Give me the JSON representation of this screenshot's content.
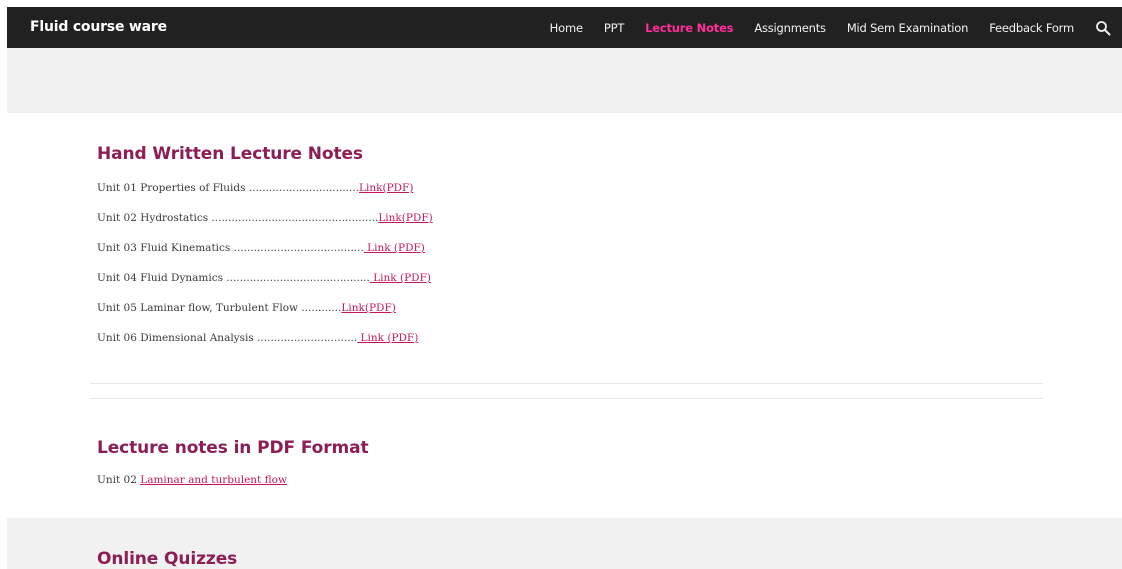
{
  "header": {
    "site_title": "Fluid course ware",
    "nav": [
      {
        "label": "Home",
        "active": false
      },
      {
        "label": "PPT",
        "active": false
      },
      {
        "label": "Lecture Notes",
        "active": true
      },
      {
        "label": "Assignments",
        "active": false
      },
      {
        "label": "Mid Sem Examination",
        "active": false
      },
      {
        "label": "Feedback Form",
        "active": false
      }
    ],
    "search_icon": "search-icon"
  },
  "handwritten": {
    "heading": "Hand Written Lecture Notes",
    "items": [
      {
        "label": "Unit 01 Properties of Fluids .................................",
        "link": "Link(PDF)"
      },
      {
        "label": "Unit 02 Hydrostatics ..................................................",
        "link": "Link(PDF)"
      },
      {
        "label": "Unit 03 Fluid Kinematics  .......................................",
        "link": " Link (PDF)"
      },
      {
        "label": "Unit 04 Fluid Dynamics ...........................................",
        "link": " Link (PDF)"
      },
      {
        "label": "Unit 05 Laminar flow, Turbulent Flow ............",
        "link": "Link(PDF)"
      },
      {
        "label": "Unit 06 Dimensional Analysis ..............................",
        "link": " Link (PDF)"
      }
    ]
  },
  "pdf_format": {
    "heading": "Lecture notes in PDF Format",
    "prefix": "Unit 02 ",
    "link": "Laminar and turbulent flow"
  },
  "quizzes": {
    "heading": "Online Quizzes"
  },
  "colors": {
    "navbar_bg": "#212121",
    "accent_active": "#ff2d9b",
    "heading": "#8c1d55",
    "link": "#c2185b",
    "band_bg": "#f1f1f1"
  }
}
